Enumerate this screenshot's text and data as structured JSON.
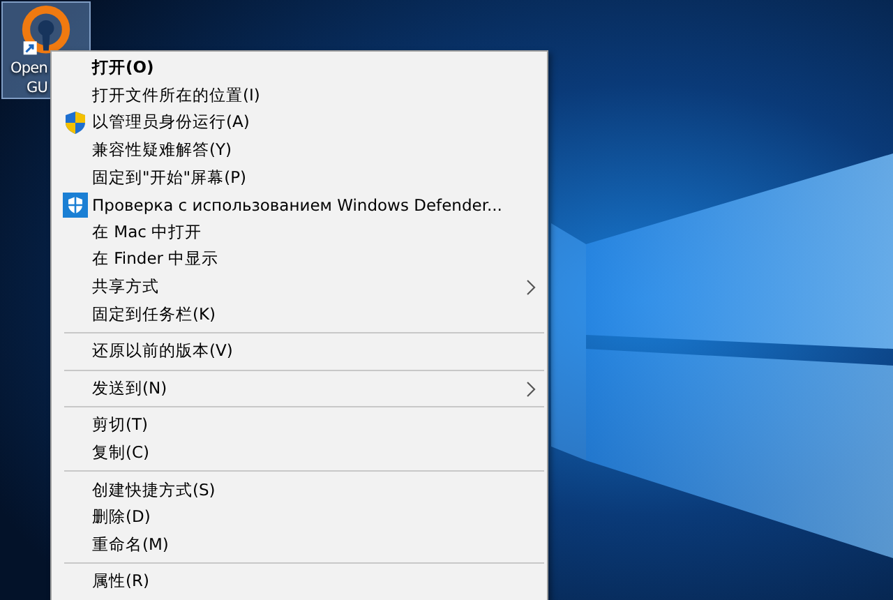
{
  "desktop_icon": {
    "label_lines": [
      "Open",
      "GU"
    ],
    "selected": true
  },
  "context_menu": {
    "items": [
      {
        "kind": "item",
        "label": "打开(O)",
        "default": true,
        "submenu": false
      },
      {
        "kind": "item",
        "label": "打开文件所在的位置(I)",
        "default": false,
        "submenu": false
      },
      {
        "kind": "shield-item",
        "label": "以管理员身份运行(A)",
        "default": false,
        "submenu": false
      },
      {
        "kind": "item",
        "label": "兼容性疑难解答(Y)",
        "default": false,
        "submenu": false
      },
      {
        "kind": "item",
        "label": "固定到\"开始\"屏幕(P)",
        "default": false,
        "submenu": false
      },
      {
        "kind": "scan-item",
        "label": "Проверка с использованием Windows Defender...",
        "default": false,
        "submenu": false
      },
      {
        "kind": "item",
        "label": "在 Mac 中打开",
        "default": false,
        "submenu": false
      },
      {
        "kind": "item",
        "label": "在 Finder 中显示",
        "default": false,
        "submenu": false
      },
      {
        "kind": "item",
        "label": "共享方式",
        "default": false,
        "submenu": true
      },
      {
        "kind": "item",
        "label": "固定到任务栏(K)",
        "default": false,
        "submenu": false
      },
      {
        "kind": "separator"
      },
      {
        "kind": "item",
        "label": "还原以前的版本(V)",
        "default": false,
        "submenu": false
      },
      {
        "kind": "separator"
      },
      {
        "kind": "item",
        "label": "发送到(N)",
        "default": false,
        "submenu": true
      },
      {
        "kind": "separator"
      },
      {
        "kind": "item",
        "label": "剪切(T)",
        "default": false,
        "submenu": false
      },
      {
        "kind": "item",
        "label": "复制(C)",
        "default": false,
        "submenu": false
      },
      {
        "kind": "separator"
      },
      {
        "kind": "item",
        "label": "创建快捷方式(S)",
        "default": false,
        "submenu": false
      },
      {
        "kind": "item",
        "label": "删除(D)",
        "default": false,
        "submenu": false
      },
      {
        "kind": "item",
        "label": "重命名(M)",
        "default": false,
        "submenu": false
      },
      {
        "kind": "separator"
      },
      {
        "kind": "item",
        "label": "属性(R)",
        "default": false,
        "submenu": false
      }
    ]
  }
}
